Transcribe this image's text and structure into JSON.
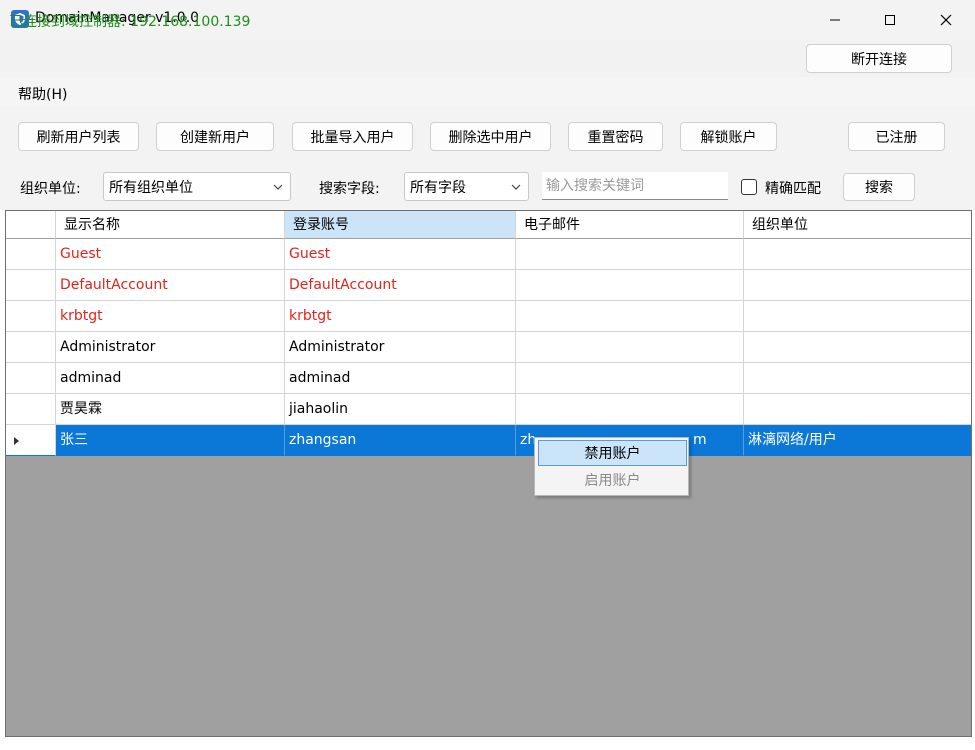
{
  "window": {
    "title": "DomainManager v1.0.0"
  },
  "status": {
    "text": "已连接到域控制器: 192.168.100.139",
    "disconnect_label": "断开连接"
  },
  "menu": {
    "help": "帮助(H)"
  },
  "toolbar": {
    "refresh": "刷新用户列表",
    "create": "创建新用户",
    "import": "批量导入用户",
    "delete": "删除选中用户",
    "reset": "重置密码",
    "unlock": "解锁账户",
    "registered": "已注册"
  },
  "filters": {
    "org_label": "组织单位:",
    "org_value": "所有组织单位",
    "field_label": "搜索字段:",
    "field_value": "所有字段",
    "search_placeholder": "输入搜索关键词",
    "exact_label": "精确匹配",
    "search_button": "搜索"
  },
  "grid": {
    "columns": [
      "显示名称",
      "登录账号",
      "电子邮件",
      "组织单位"
    ],
    "rows": [
      {
        "display": "Guest",
        "login": "Guest",
        "email": "",
        "ou": ""
      },
      {
        "display": "DefaultAccount",
        "login": "DefaultAccount",
        "email": "",
        "ou": ""
      },
      {
        "display": "krbtgt",
        "login": "krbtgt",
        "email": "",
        "ou": ""
      },
      {
        "display": "Administrator",
        "login": "Administrator",
        "email": "",
        "ou": ""
      },
      {
        "display": "adminad",
        "login": "adminad",
        "email": "",
        "ou": ""
      },
      {
        "display": "贾昊霖",
        "login": "jiahaolin",
        "email": "",
        "ou": ""
      },
      {
        "display": "张三",
        "login": "zhangsan",
        "email": "zh",
        "email_tail": "m",
        "ou": "淋漓网络/用户"
      }
    ]
  },
  "context_menu": {
    "disable": "禁用账户",
    "enable": "启用账户"
  },
  "colors": {
    "status_green": "#1a8f1a",
    "disabled_red": "#e2231a",
    "selection_blue": "#0b78d7",
    "grid_background": "#a0a0a0"
  }
}
